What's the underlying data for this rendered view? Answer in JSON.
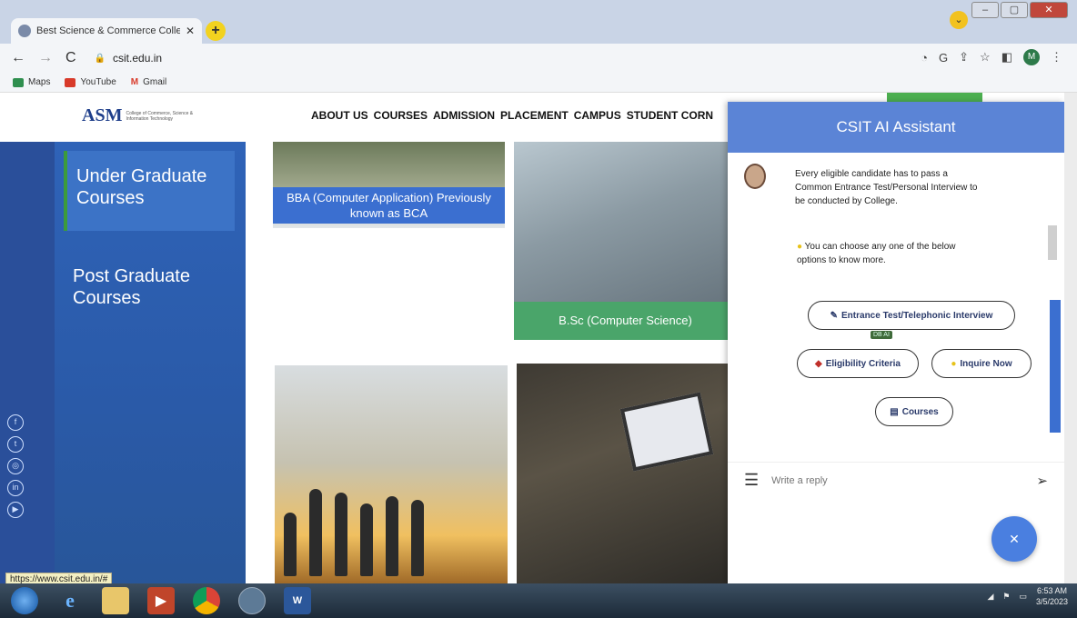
{
  "browser": {
    "tab_title": "Best Science & Commerce Colle",
    "tab_close": "✕",
    "new_tab": "+",
    "url": "csit.edu.in",
    "bookmarks": [
      {
        "label": "Maps",
        "color": "#2f8f4f"
      },
      {
        "label": "YouTube",
        "color": "#d83a2a"
      },
      {
        "label": "Gmail",
        "color": "#d83a2a"
      }
    ]
  },
  "header": {
    "logo_mark": "ASM",
    "logo_subtitle": "College of Commerce, Science & Information Technology",
    "nav": [
      "ABOUT US",
      "COURSES",
      "ADMISSION",
      "PLACEMENT",
      "CAMPUS",
      "STUDENT CORN"
    ]
  },
  "sidebar": {
    "items": [
      {
        "label": "Under Graduate Courses"
      },
      {
        "label": "Post Graduate Courses"
      }
    ]
  },
  "cards": {
    "bba": "BBA (Computer Application) Previously known as BCA",
    "bsc": "B.Sc (Computer Science)"
  },
  "chat": {
    "title": "CSIT AI Assistant",
    "message1": "Every eligible candidate has to pass a Common Entrance Test/Personal Interview to be conducted by College.",
    "message2": "You can choose any one of the below options to know more.",
    "options": {
      "entrance": "Entrance Test/Telephonic Interview",
      "eligibility": "Eligibility Criteria",
      "inquire": "Inquire Now",
      "courses": "Courses"
    },
    "tooltip": "DB AI",
    "reply_placeholder": "Write a reply",
    "close_label": "✕"
  },
  "status_url": "https://www.csit.edu.in/#",
  "taskbar": {
    "time": "6:53 AM",
    "date": "3/5/2023"
  },
  "colors": {
    "accent_blue": "#5b84d6",
    "sidebar_blue": "#2f63b8",
    "card_green": "#4aa56a",
    "fab_blue": "#4a7fe0"
  }
}
